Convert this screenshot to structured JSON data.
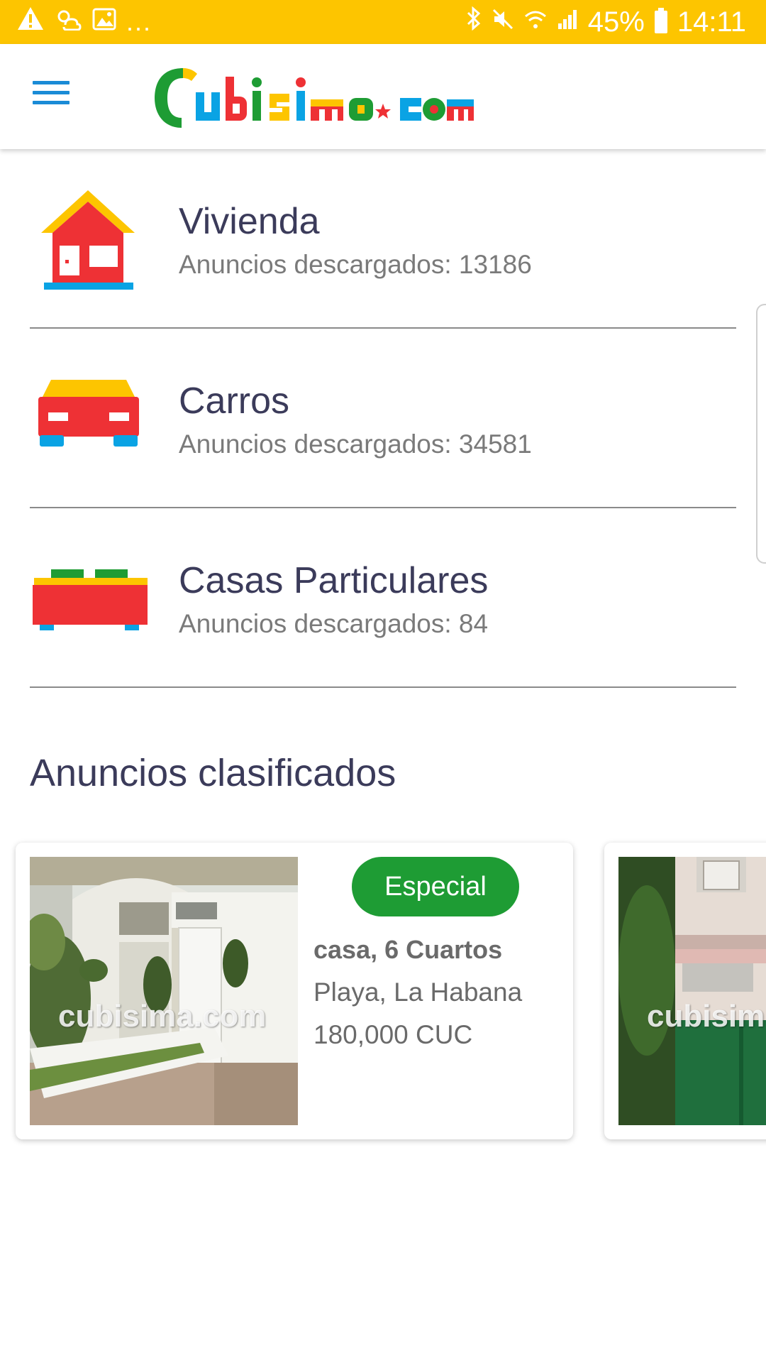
{
  "status_bar": {
    "dots": "...",
    "battery": "45%",
    "time": "14:11",
    "icons": [
      "warning-icon",
      "weather-icon",
      "image-icon",
      "bluetooth-icon",
      "mute-icon",
      "wifi-icon",
      "signal-icon",
      "battery-icon"
    ]
  },
  "app_bar": {
    "logo_text": "Cubisima.com",
    "menu_icon": "hamburger-menu-icon"
  },
  "categories": [
    {
      "title": "Vivienda",
      "subtitle": "Anuncios descargados: 13186",
      "icon": "house-icon"
    },
    {
      "title": "Carros",
      "subtitle": "Anuncios descargados: 34581",
      "icon": "car-icon"
    },
    {
      "title": "Casas Particulares",
      "subtitle": "Anuncios descargados: 84",
      "icon": "bed-icon"
    }
  ],
  "section": {
    "title": "Anuncios clasificados"
  },
  "cards": [
    {
      "badge": "Especial",
      "title": "casa, 6 Cuartos",
      "location": "Playa, La Habana",
      "price": "180,000 CUC",
      "watermark": "cubisima.com"
    },
    {
      "watermark": "cubisim"
    }
  ],
  "colors": {
    "status_bar": "#fdc500",
    "accent_blue": "#1a8bd6",
    "red": "#ee3135",
    "yellow": "#fdc500",
    "green": "#1e9c34",
    "cyan": "#0aa3e4"
  }
}
